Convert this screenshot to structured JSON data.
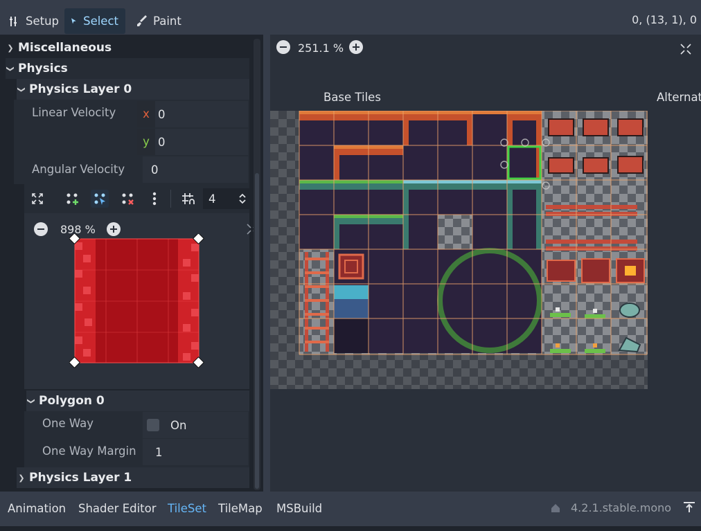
{
  "toolbar": {
    "setup_label": "Setup",
    "select_label": "Select",
    "paint_label": "Paint",
    "coords": "0, (13, 1), 0"
  },
  "inspector": {
    "misc_label": "Miscellaneous",
    "physics_label": "Physics",
    "physics_layer0_label": "Physics Layer 0",
    "linear_velocity_label": "Linear Velocity",
    "linear_x_axis": "x",
    "linear_x_value": "0",
    "linear_y_axis": "y",
    "linear_y_value": "0",
    "angular_velocity_label": "Angular Velocity",
    "angular_value": "0",
    "snap_value": "4",
    "polygon_zoom": "898 %",
    "polygon0_label": "Polygon 0",
    "one_way_label": "One Way",
    "one_way_value": "On",
    "one_way_margin_label": "One Way Margin",
    "one_way_margin_value": "1",
    "physics_layer1_label": "Physics Layer 1"
  },
  "tileview": {
    "zoom": "251.1 %",
    "base_tiles_label": "Base Tiles",
    "alternative_label": "Alternat"
  },
  "bottom": {
    "tabs": [
      "Animation",
      "Shader Editor",
      "TileSet",
      "TileMap",
      "MSBuild"
    ],
    "active_tab": "TileSet",
    "version": "4.2.1.stable.mono"
  },
  "colors": {
    "accent": "#66b6f6",
    "selection": "#44d044",
    "polygon": "#c4121c",
    "grid": "#e8a06a"
  }
}
